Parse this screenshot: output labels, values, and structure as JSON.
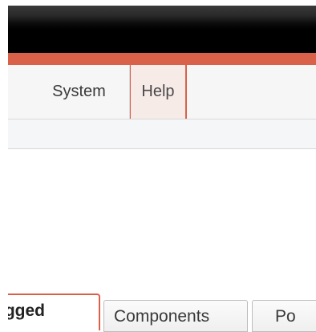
{
  "menubar": {
    "items": [
      {
        "label": "System"
      },
      {
        "label": "Help"
      }
    ]
  },
  "tabs": [
    {
      "label": "ıgged"
    },
    {
      "label": "Components"
    },
    {
      "label": "Po"
    }
  ],
  "colors": {
    "accent": "#d9614a",
    "titlebar": "#000000",
    "menubar_bg": "#f6f6f6",
    "active_menu_bg": "#f7ebe8"
  }
}
